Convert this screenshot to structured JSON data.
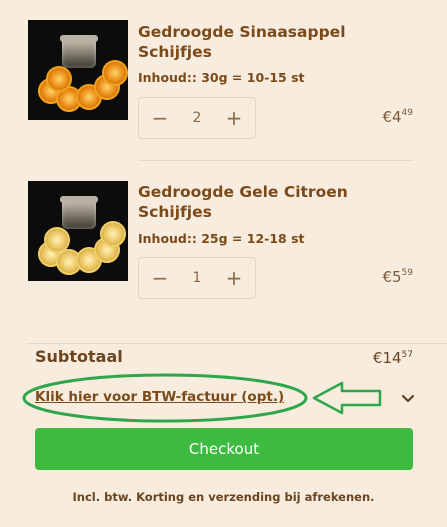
{
  "cart": {
    "items": [
      {
        "title": "Gedroogde Sinaasappel Schijfjes",
        "variant": "Inhoud:: 30g = 10-15 st",
        "quantity": "2",
        "price_main": "€4",
        "price_cents": "49",
        "image": "dried-orange-slices-jar"
      },
      {
        "title": "Gedroogde Gele Citroen Schijfjes",
        "variant": "Inhoud:: 25g = 12-18 st",
        "quantity": "1",
        "price_main": "€5",
        "price_cents": "59",
        "image": "dried-lemon-slices-jar"
      }
    ],
    "stepper": {
      "minus": "−",
      "plus": "+"
    }
  },
  "summary": {
    "subtotal_label": "Subtotaal",
    "subtotal_main": "€14",
    "subtotal_cents": "57",
    "btw_link": "Klik hier voor BTW-factuur (opt.)",
    "checkout_label": "Checkout",
    "footnote": "Incl. btw. Korting en verzending bij afrekenen."
  },
  "colors": {
    "background": "#f8ecde",
    "text_brown": "#7a4a1a",
    "checkout_green": "#3dbb41",
    "annotation_green": "#2ea64a"
  },
  "icons": {
    "expand": "chevron-down-icon",
    "annotation_arrow": "left-arrow-icon"
  }
}
